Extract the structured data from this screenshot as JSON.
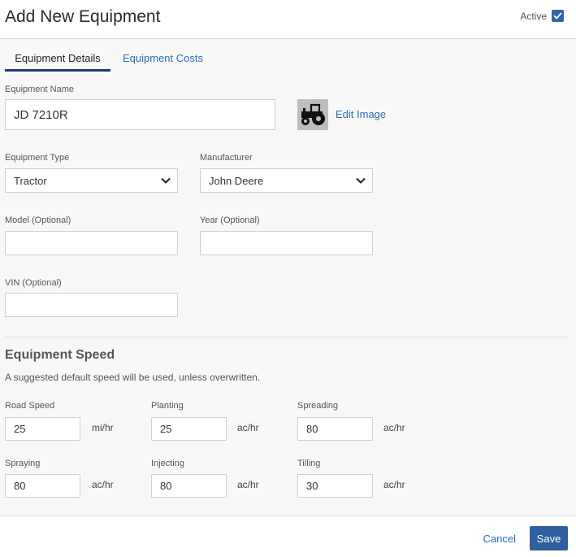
{
  "header": {
    "title": "Add New Equipment",
    "active_label": "Active",
    "active_checked": true
  },
  "tabs": [
    {
      "label": "Equipment Details",
      "active": true
    },
    {
      "label": "Equipment Costs",
      "active": false
    }
  ],
  "details": {
    "equipment_name": {
      "label": "Equipment Name",
      "value": "JD 7210R"
    },
    "edit_image_label": "Edit Image",
    "image_icon": "tractor-icon",
    "equipment_type": {
      "label": "Equipment Type",
      "value": "Tractor"
    },
    "manufacturer": {
      "label": "Manufacturer",
      "value": "John Deere"
    },
    "model": {
      "label": "Model (Optional)",
      "value": ""
    },
    "year": {
      "label": "Year (Optional)",
      "value": ""
    },
    "vin": {
      "label": "VIN (Optional)",
      "value": ""
    }
  },
  "speed": {
    "title": "Equipment Speed",
    "description": "A suggested default speed will be used, unless overwritten.",
    "road_speed": {
      "label": "Road Speed",
      "value": "25",
      "unit": "mi/hr"
    },
    "planting": {
      "label": "Planting",
      "value": "25",
      "unit": "ac/hr"
    },
    "spreading": {
      "label": "Spreading",
      "value": "80",
      "unit": "ac/hr"
    },
    "spraying": {
      "label": "Spraying",
      "value": "80",
      "unit": "ac/hr"
    },
    "injecting": {
      "label": "Injecting",
      "value": "80",
      "unit": "ac/hr"
    },
    "tilling": {
      "label": "Tilling",
      "value": "30",
      "unit": "ac/hr"
    }
  },
  "footer": {
    "cancel_label": "Cancel",
    "save_label": "Save"
  },
  "colors": {
    "accent": "#2f66a6",
    "link": "#2d6db5",
    "tab_underline": "#1f3c73"
  }
}
